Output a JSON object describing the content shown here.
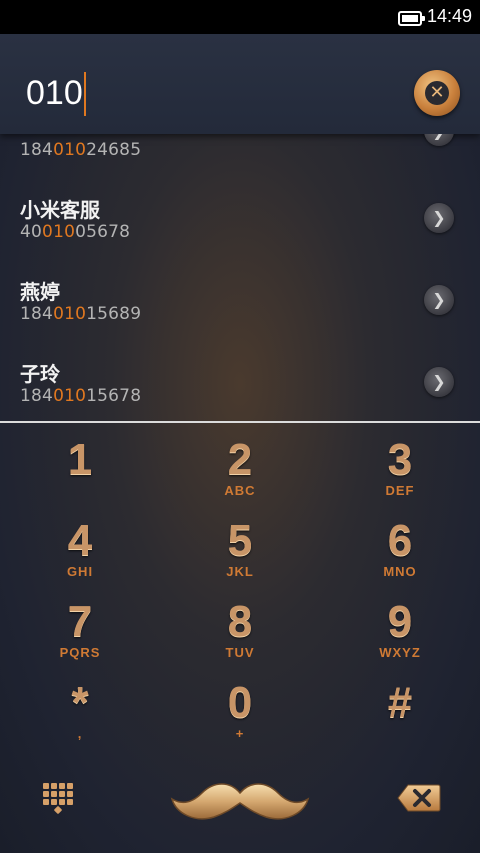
{
  "status_bar": {
    "time": "14:49"
  },
  "dialer": {
    "input": "010"
  },
  "results": [
    {
      "name": "",
      "number_pre": "184",
      "number_match": "010",
      "number_post": "24685"
    },
    {
      "name": "小米客服",
      "number_pre": "40",
      "number_match": "010",
      "number_post": "05678"
    },
    {
      "name": "燕婷",
      "number_pre": "184",
      "number_match": "010",
      "number_post": "15689"
    },
    {
      "name": "子玲",
      "number_pre": "184",
      "number_match": "010",
      "number_post": "15678"
    }
  ],
  "keypad": [
    {
      "digit": "1",
      "letters": ""
    },
    {
      "digit": "2",
      "letters": "ABC"
    },
    {
      "digit": "3",
      "letters": "DEF"
    },
    {
      "digit": "4",
      "letters": "GHI"
    },
    {
      "digit": "5",
      "letters": "JKL"
    },
    {
      "digit": "6",
      "letters": "MNO"
    },
    {
      "digit": "7",
      "letters": "PQRS"
    },
    {
      "digit": "8",
      "letters": "TUV"
    },
    {
      "digit": "9",
      "letters": "WXYZ"
    },
    {
      "digit": "*",
      "letters": ","
    },
    {
      "digit": "0",
      "letters": "+"
    },
    {
      "digit": "#",
      "letters": ""
    }
  ],
  "icons": {
    "battery": "battery-icon",
    "clear": "close-icon",
    "chevron": "chevron-right-icon",
    "keypad_toggle": "dialpad-icon",
    "call": "mustache-call-icon",
    "delete": "backspace-icon"
  },
  "colors": {
    "accent": "#e07820",
    "digits": "#c89567"
  }
}
